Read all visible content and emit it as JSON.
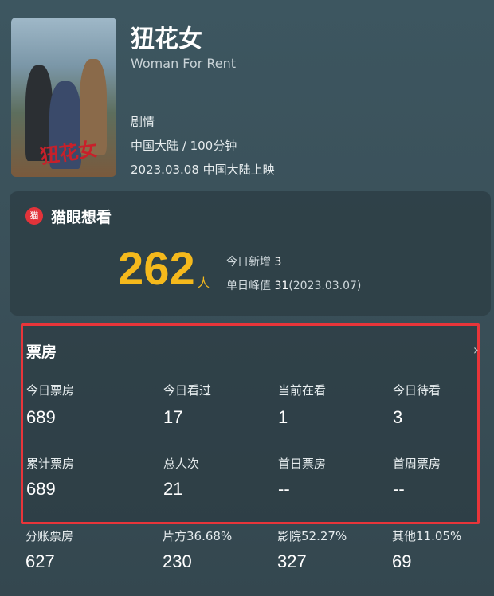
{
  "movie": {
    "title_cn": "狃花女",
    "title_en": "Woman For Rent",
    "genre": "剧情",
    "region_duration": "中国大陆 / 100分钟",
    "release": "2023.03.08 中国大陆上映",
    "poster_title_art": "狃花女"
  },
  "want": {
    "title": "猫眼想看",
    "icon_text": "猫",
    "count": "262",
    "unit": "人",
    "today_new_label": "今日新增",
    "today_new_value": "3",
    "peak_label": "单日峰值",
    "peak_value": "31",
    "peak_date": "(2023.03.07)"
  },
  "box_office": {
    "title": "票房",
    "chevron": "›",
    "row1": [
      {
        "label": "今日票房",
        "value": "689"
      },
      {
        "label": "今日看过",
        "value": "17"
      },
      {
        "label": "当前在看",
        "value": "1"
      },
      {
        "label": "今日待看",
        "value": "3"
      }
    ],
    "row2": [
      {
        "label": "累计票房",
        "value": "689"
      },
      {
        "label": "总人次",
        "value": "21"
      },
      {
        "label": "首日票房",
        "value": "--"
      },
      {
        "label": "首周票房",
        "value": "--"
      }
    ]
  },
  "split": [
    {
      "label": "分账票房",
      "value": "627"
    },
    {
      "label": "片方36.68%",
      "value": "230"
    },
    {
      "label": "影院52.27%",
      "value": "327"
    },
    {
      "label": "其他11.05%",
      "value": "69"
    }
  ],
  "colors": {
    "accent_yellow": "#f5b91c",
    "highlight_red": "#e8353a",
    "brand_red": "#e2333a"
  }
}
